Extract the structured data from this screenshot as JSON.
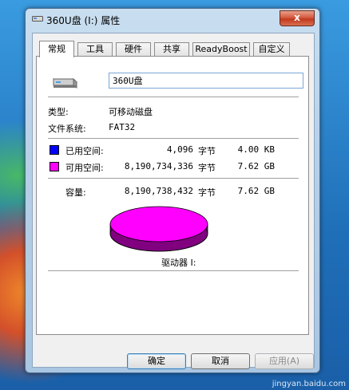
{
  "window": {
    "title": "360U盘 (I:) 属性",
    "close_label": "x"
  },
  "tabs": [
    {
      "label": "常规",
      "active": true
    },
    {
      "label": "工具"
    },
    {
      "label": "硬件"
    },
    {
      "label": "共享"
    },
    {
      "label": "ReadyBoost"
    },
    {
      "label": "自定义"
    }
  ],
  "general": {
    "drive_name_value": "360U盘",
    "type_label": "类型:",
    "type_value": "可移动磁盘",
    "fs_label": "文件系统:",
    "fs_value": "FAT32",
    "used": {
      "label": "已用空间:",
      "bytes": "4,096",
      "unit": "字节",
      "size": "4.00 KB",
      "color": "#0000ff"
    },
    "free": {
      "label": "可用空间:",
      "bytes": "8,190,734,336",
      "unit": "字节",
      "size": "7.62 GB",
      "color": "#ff00ff"
    },
    "capacity": {
      "label": "容量:",
      "bytes": "8,190,738,432",
      "unit": "字节",
      "size": "7.62 GB"
    },
    "drive_label": "驱动器 I:"
  },
  "buttons": {
    "ok": "确定",
    "cancel": "取消",
    "apply": "应用(A)"
  },
  "watermark": "jingyan.baidu.com"
}
